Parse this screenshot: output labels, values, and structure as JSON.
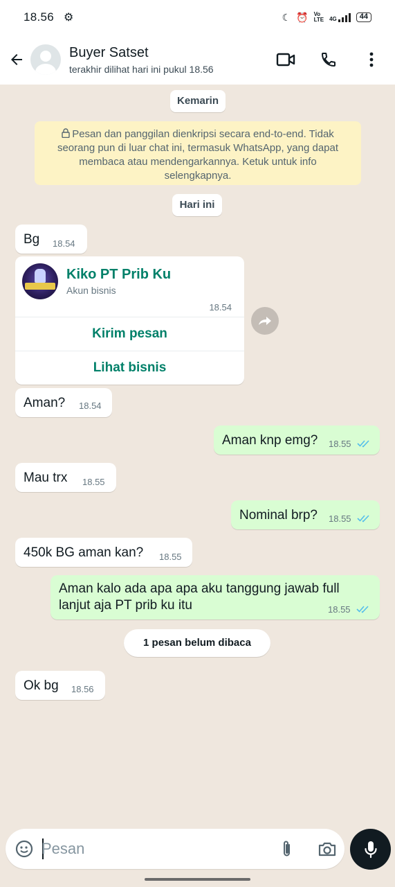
{
  "status_bar": {
    "time": "18.56",
    "battery": "44",
    "net": "4G"
  },
  "header": {
    "contact_name": "Buyer Satset",
    "last_seen": "terakhir dilihat hari ini pukul 18.56"
  },
  "chat": {
    "date_yesterday": "Kemarin",
    "encryption_notice": "Pesan dan panggilan dienkripsi secara end-to-end. Tidak seorang pun di luar chat ini, termasuk WhatsApp, yang dapat membaca atau mendengarkannya. Ketuk untuk info selengkapnya.",
    "date_today": "Hari ini",
    "unread_label": "1 pesan belum dibaca",
    "messages": [
      {
        "direction": "in",
        "text": "Bg",
        "time": "18.54"
      },
      {
        "direction": "in",
        "text": "Aman?",
        "time": "18.54"
      },
      {
        "direction": "out",
        "text": "Aman knp emg?",
        "time": "18.55",
        "status": "read"
      },
      {
        "direction": "in",
        "text": "Mau trx",
        "time": "18.55"
      },
      {
        "direction": "out",
        "text": "Nominal brp?",
        "time": "18.55",
        "status": "read"
      },
      {
        "direction": "in",
        "text": "450k BG aman kan?",
        "time": "18.55"
      },
      {
        "direction": "out",
        "text_line1": "Aman kalo ada apa apa aku tanggung jawab full",
        "text_line2": "lanjut aja PT prib ku itu",
        "time": "18.55",
        "status": "read"
      },
      {
        "direction": "in",
        "text": "Ok bg",
        "time": "18.56"
      }
    ],
    "business_card": {
      "name": "Kiko PT Prib Ku",
      "subtitle": "Akun bisnis",
      "time": "18.54",
      "action_message": "Kirim pesan",
      "action_view": "Lihat bisnis"
    }
  },
  "input": {
    "placeholder": "Pesan"
  },
  "colors": {
    "wallpaper": "#efe7de",
    "outgoing_bubble": "#d9fdd3",
    "accent_green": "#008069",
    "read_tick_blue": "#53bdeb",
    "notice_yellow": "#fdf3c5"
  }
}
